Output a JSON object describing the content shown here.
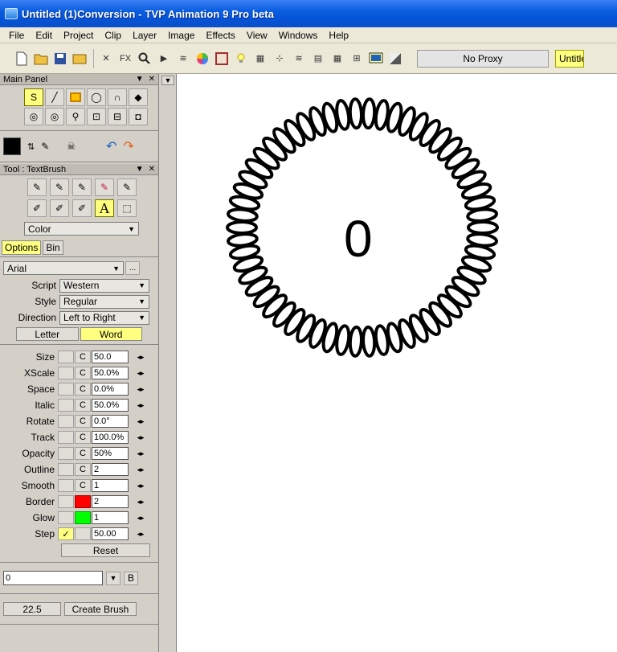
{
  "window": {
    "title": "Untitled (1)Conversion - TVP Animation 9 Pro beta"
  },
  "menu": [
    "File",
    "Edit",
    "Project",
    "Clip",
    "Layer",
    "Image",
    "Effects",
    "View",
    "Windows",
    "Help"
  ],
  "toolbar": {
    "proxy": "No Proxy",
    "tab": "Untitled"
  },
  "main_panel": {
    "title": "Main Panel"
  },
  "tool_panel": {
    "title": "Tool : TextBrush",
    "color_mode": "Color",
    "tabs": [
      "Options",
      "Bin"
    ],
    "font": "Arial",
    "script_label": "Script",
    "script_value": "Western",
    "style_label": "Style",
    "style_value": "Regular",
    "direction_label": "Direction",
    "direction_value": "Left to Right",
    "mode_letter": "Letter",
    "mode_word": "Word",
    "params": [
      {
        "label": "Size",
        "value": "50.0"
      },
      {
        "label": "XScale",
        "value": "50.0%"
      },
      {
        "label": "Space",
        "value": "0.0%"
      },
      {
        "label": "Italic",
        "value": "50.0%"
      },
      {
        "label": "Rotate",
        "value": "0.0°"
      },
      {
        "label": "Track",
        "value": "100.0%"
      },
      {
        "label": "Opacity",
        "value": "50%"
      },
      {
        "label": "Outline",
        "value": "2"
      },
      {
        "label": "Smooth",
        "value": "1"
      }
    ],
    "border": {
      "label": "Border",
      "value": "2",
      "color": "#ff0000"
    },
    "glow": {
      "label": "Glow",
      "value": "1",
      "color": "#00ff00"
    },
    "step": {
      "label": "Step",
      "value": "50.00"
    },
    "reset": "Reset",
    "text_input": "0",
    "b_label": "B",
    "angle": "22.5",
    "create_brush": "Create Brush",
    "c_label": "C"
  },
  "canvas": {
    "text": "0"
  }
}
